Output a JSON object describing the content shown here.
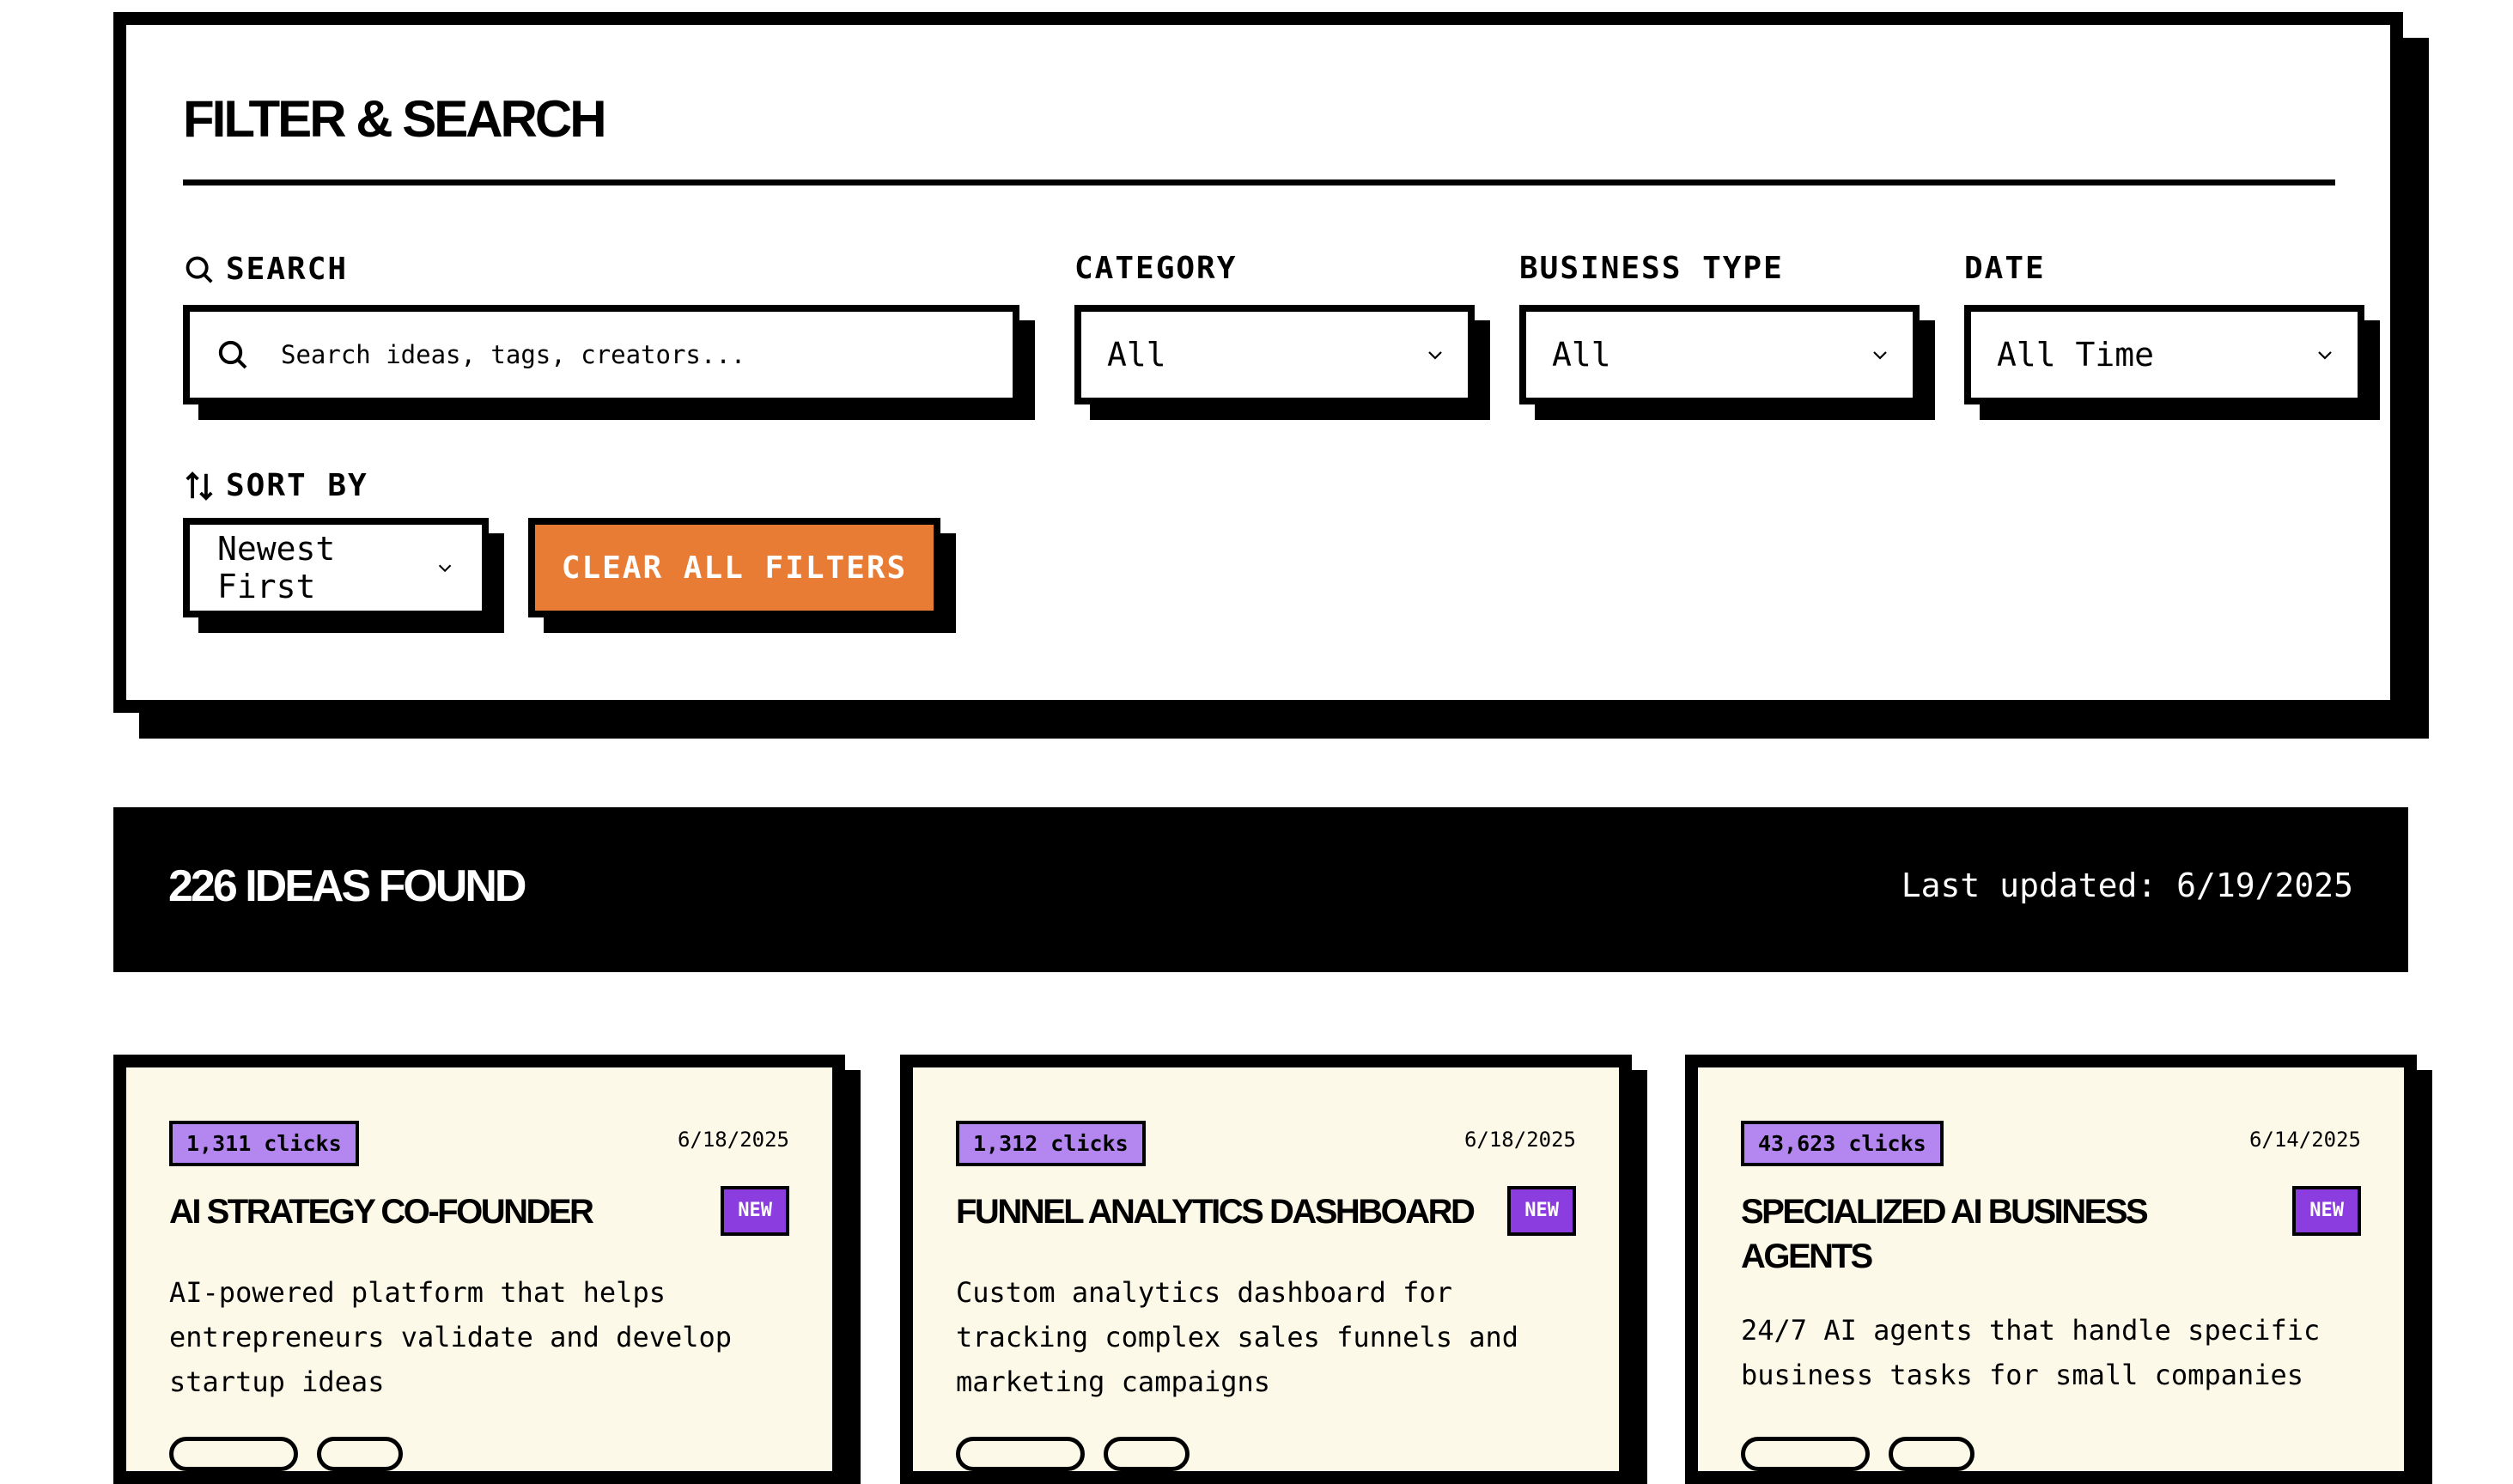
{
  "filter": {
    "title": "FILTER & SEARCH",
    "search_label": "SEARCH",
    "search_placeholder": "Search ideas, tags, creators...",
    "category_label": "CATEGORY",
    "category_value": "All",
    "business_type_label": "BUSINESS TYPE",
    "business_type_value": "All",
    "date_label": "DATE",
    "date_value": "All Time",
    "sort_label": "SORT BY",
    "sort_value": "Newest First",
    "clear_label": "CLEAR ALL FILTERS"
  },
  "results": {
    "count_label": "226 IDEAS FOUND",
    "updated_label": "Last updated: 6/19/2025"
  },
  "cards": [
    {
      "clicks": "1,311 clicks",
      "date": "6/18/2025",
      "title": "AI STRATEGY CO-FOUNDER",
      "badge": "NEW",
      "description": "AI-powered platform that helps entrepreneurs validate and develop startup ideas"
    },
    {
      "clicks": "1,312 clicks",
      "date": "6/18/2025",
      "title": "FUNNEL ANALYTICS DASHBOARD",
      "badge": "NEW",
      "description": "Custom analytics dashboard for tracking complex sales funnels and marketing campaigns"
    },
    {
      "clicks": "43,623 clicks",
      "date": "6/14/2025",
      "title": "SPECIALIZED AI BUSINESS AGENTS",
      "badge": "NEW",
      "description": "24/7 AI agents that handle specific business tasks for small companies"
    }
  ],
  "colors": {
    "accent_orange": "#e97c35",
    "clicks_purple": "#b487f0",
    "new_purple": "#8b3de0",
    "card_bg": "#fdf9e8"
  },
  "icons": {
    "search": "search-icon",
    "sort": "sort-arrows-icon",
    "chevron": "chevron-down-icon"
  }
}
